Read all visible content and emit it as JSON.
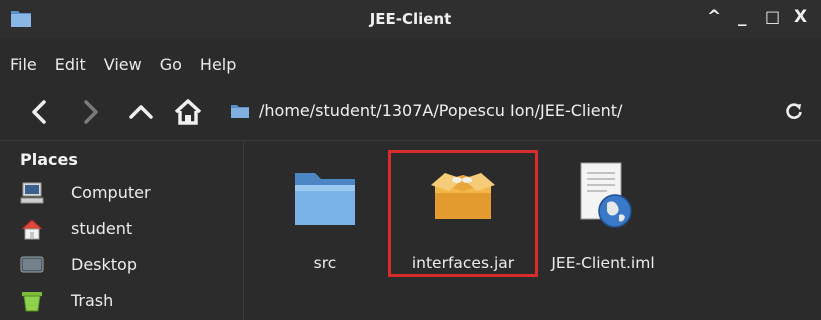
{
  "window": {
    "title": "JEE-Client",
    "controls": [
      "^",
      "_",
      "□",
      "X"
    ]
  },
  "menu": [
    "File",
    "Edit",
    "View",
    "Go",
    "Help"
  ],
  "toolbar": {
    "path": "/home/student/1307A/Popescu Ion/JEE-Client/"
  },
  "sidebar": {
    "title": "Places",
    "items": [
      {
        "label": "Computer",
        "icon": "computer-icon"
      },
      {
        "label": "student",
        "icon": "home-icon"
      },
      {
        "label": "Desktop",
        "icon": "desktop-icon"
      },
      {
        "label": "Trash",
        "icon": "trash-icon"
      }
    ]
  },
  "files": [
    {
      "name": "src",
      "icon": "folder-icon"
    },
    {
      "name": "interfaces.jar",
      "icon": "package-icon",
      "highlighted": true
    },
    {
      "name": "JEE-Client.iml",
      "icon": "document-globe-icon"
    }
  ],
  "colors": {
    "background": "#2b2b2b",
    "highlight": "#d62c2c",
    "folder_blue": "#6aa3dc"
  }
}
